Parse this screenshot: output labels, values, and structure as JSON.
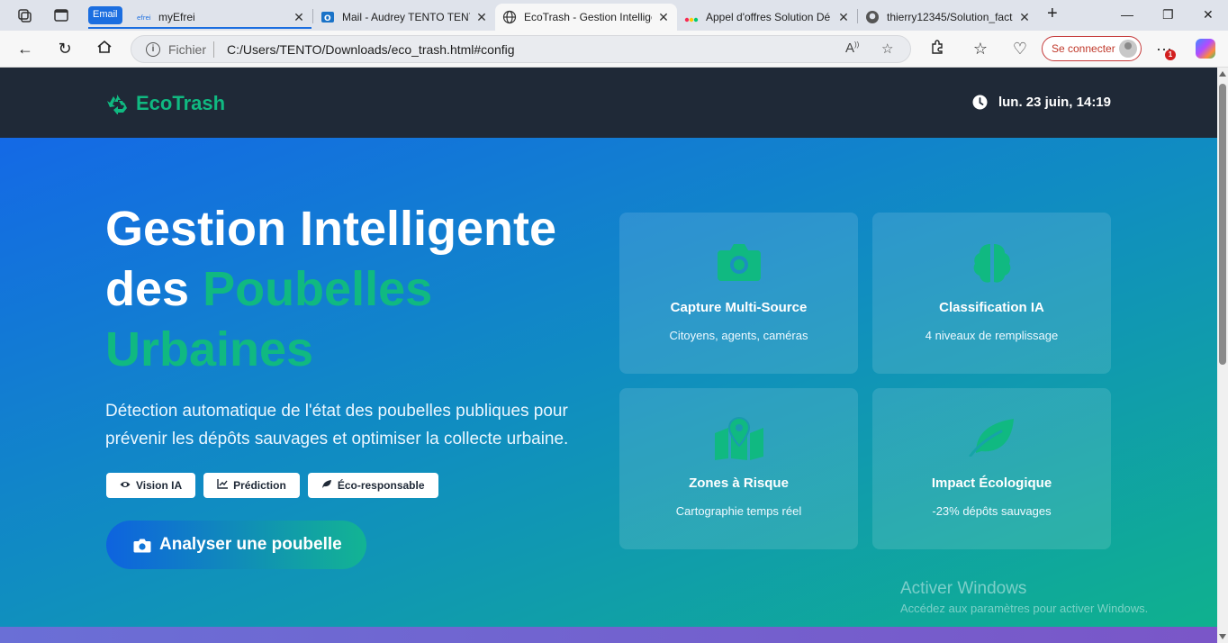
{
  "browser": {
    "tab_group_label": "Email",
    "tabs": [
      {
        "title": "myEfrei",
        "favicon": "efrei-icon"
      },
      {
        "title": "Mail - Audrey TENTO TENTO",
        "favicon": "outlook-icon"
      },
      {
        "title": "EcoTrash - Gestion Intelligente",
        "favicon": "globe-icon",
        "active": true
      },
      {
        "title": "Appel d'offres Solution Dé",
        "favicon": "monday-icon"
      },
      {
        "title": "thierry12345/Solution_fact",
        "favicon": "github-icon"
      }
    ],
    "address": {
      "scheme_label": "Fichier",
      "url": "C:/Users/TENTO/Downloads/eco_trash.html#config"
    },
    "signin_label": "Se connecter",
    "notification_count": "1"
  },
  "app": {
    "logo_text": "EcoTrash",
    "datetime": "lun. 23 juin, 14:19"
  },
  "hero": {
    "title_line1": "Gestion Intelligente",
    "title_line2_prefix": "des ",
    "title_highlight": "Poubelles Urbaines",
    "description": "Détection automatique de l'état des poubelles publiques pour prévenir les dépôts sauvages et optimiser la collecte urbaine.",
    "chips": [
      {
        "label": "Vision IA",
        "icon": "eye-icon"
      },
      {
        "label": "Prédiction",
        "icon": "chart-line-icon"
      },
      {
        "label": "Éco-responsable",
        "icon": "leaf-icon"
      }
    ],
    "cta_label": "Analyser une poubelle"
  },
  "features": [
    {
      "title": "Capture Multi-Source",
      "subtitle": "Citoyens, agents, caméras",
      "icon": "camera-icon"
    },
    {
      "title": "Classification IA",
      "subtitle": "4 niveaux de remplissage",
      "icon": "brain-icon"
    },
    {
      "title": "Zones à Risque",
      "subtitle": "Cartographie temps réel",
      "icon": "map-marker-icon"
    },
    {
      "title": "Impact Écologique",
      "subtitle": "-23% dépôts sauvages",
      "icon": "leaf-icon"
    }
  ],
  "watermark": {
    "line1": "Activer Windows",
    "line2": "Accédez aux paramètres pour activer Windows."
  },
  "colors": {
    "accent_green": "#10b981",
    "header_bg": "#1f2937",
    "hero_gradient_start": "#1469e6",
    "hero_gradient_end": "#0fb18e"
  }
}
